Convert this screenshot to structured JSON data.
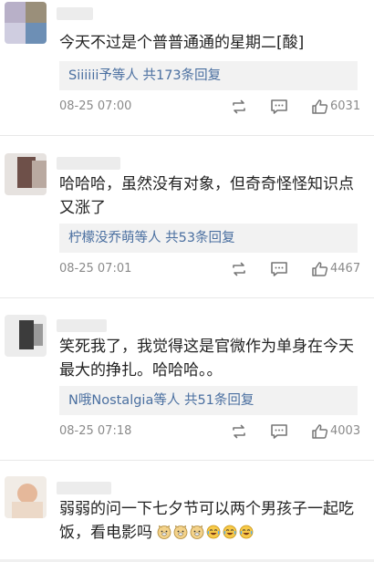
{
  "comments": [
    {
      "text": "今天不过是个普普通通的星期二[酸]",
      "replies": "Siiiiii予等人 共173条回复",
      "time": "08-25 07:00",
      "likes": "6031"
    },
    {
      "text": "哈哈哈，虽然没有对象，但奇奇怪怪知识点又涨了",
      "replies": "柠檬没乔萌等人 共53条回复",
      "time": "08-25 07:01",
      "likes": "4467"
    },
    {
      "text": "笑死我了，我觉得这是官微作为单身在今天最大的挣扎。哈哈哈。。",
      "replies": "N哦Nostalgia等人 共51条回复",
      "time": "08-25 07:18",
      "likes": "4003"
    },
    {
      "text": "弱弱的问一下七夕节可以两个男孩子一起吃饭，看电影吗"
    }
  ],
  "colors": {
    "link": "#4a6fa0",
    "meta": "#8a8a8a",
    "reply_bg": "#f2f2f2"
  },
  "icons": {
    "repost": "repost-icon",
    "comment": "comment-icon",
    "like": "thumbs-up-icon",
    "emoji_dog": "doge-emoji-icon",
    "emoji_laugh": "laugh-cry-emoji-icon"
  }
}
